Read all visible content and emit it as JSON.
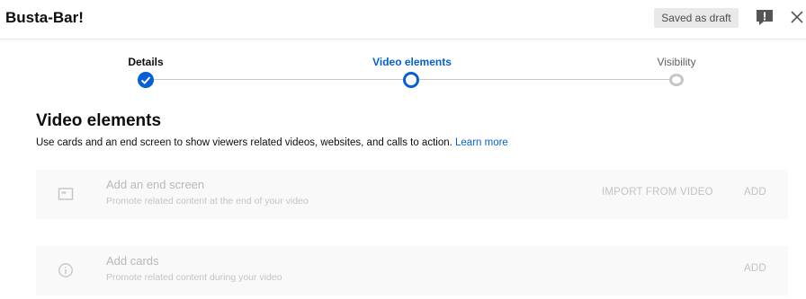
{
  "header": {
    "title": "Busta-Bar!",
    "draft_badge": "Saved as draft"
  },
  "stepper": {
    "steps": [
      {
        "label": "Details",
        "state": "done"
      },
      {
        "label": "Video elements",
        "state": "current"
      },
      {
        "label": "Visibility",
        "state": "future"
      }
    ]
  },
  "main": {
    "section_title": "Video elements",
    "description": "Use cards and an end screen to show viewers related videos, websites, and calls to action.",
    "learn_more": "Learn more",
    "cards": [
      {
        "icon": "end-screen-icon",
        "title": "Add an end screen",
        "subtitle": "Promote related content at the end of your video",
        "import_label": "IMPORT FROM VIDEO",
        "add_label": "ADD"
      },
      {
        "icon": "info-icon",
        "title": "Add cards",
        "subtitle": "Promote related content during your video",
        "add_label": "ADD"
      }
    ]
  },
  "colors": {
    "accent": "#065fd4",
    "disabled_text": "#b8b8b8",
    "card_bg": "#f9f9f9"
  }
}
